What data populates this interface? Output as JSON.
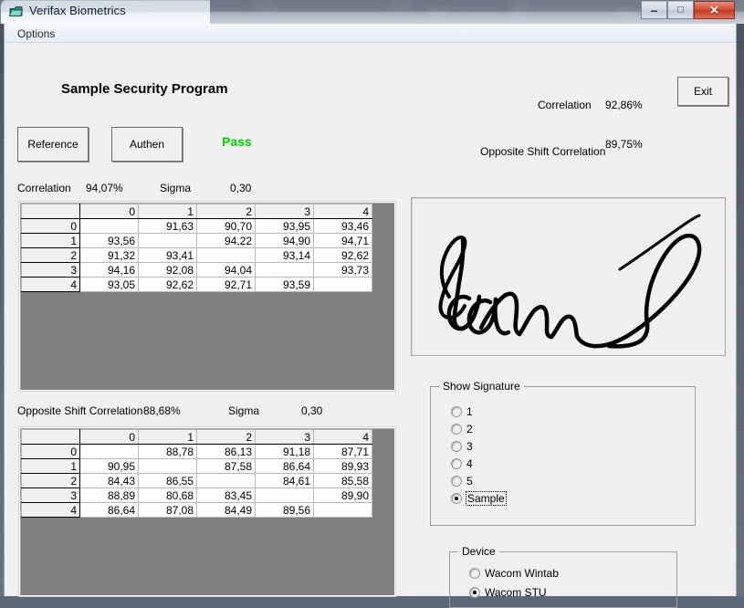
{
  "window": {
    "title": "Verifax Biometrics",
    "icon": "window-app-icon",
    "buttons": {
      "minimize": "minimize-icon",
      "maximize": "maximize-icon",
      "close": "close-icon",
      "minimize_glyph": "–",
      "maximize_glyph": "□",
      "close_glyph": "✕"
    }
  },
  "menu": {
    "items": [
      "Options"
    ],
    "options_label": "Options"
  },
  "main": {
    "heading": "Sample Security Program",
    "reference_button": "Reference",
    "authen_button": "Authen",
    "exit_button": "Exit",
    "pass_label": "Pass",
    "pass_color": "#00d400"
  },
  "summary": {
    "correlation_label": "Correlation",
    "correlation_value": "92,86%",
    "opposite_shift_label": "Opposite Shift Correlation",
    "opposite_shift_value": "89,75%"
  },
  "top_stats": {
    "correlation_label": "Correlation",
    "correlation_value": "94,07%",
    "sigma_label": "Sigma",
    "sigma_value": "0,30"
  },
  "bottom_stats": {
    "correlation_label": "Opposite Shift Correlation",
    "correlation_value": "88,68%",
    "sigma_label": "Sigma",
    "sigma_value": "0,30"
  },
  "grid_top": {
    "columns": [
      "",
      "0",
      "1",
      "2",
      "3",
      "4"
    ],
    "rows": [
      {
        "head": "0",
        "cells": [
          "",
          "91,63",
          "90,70",
          "93,95",
          "93,46"
        ]
      },
      {
        "head": "1",
        "cells": [
          "93,56",
          "",
          "94,22",
          "94,90",
          "94,71"
        ]
      },
      {
        "head": "2",
        "cells": [
          "91,32",
          "93,41",
          "",
          "93,14",
          "92,62"
        ]
      },
      {
        "head": "3",
        "cells": [
          "94,16",
          "92,08",
          "94,04",
          "",
          "93,73"
        ]
      },
      {
        "head": "4",
        "cells": [
          "93,05",
          "92,62",
          "92,71",
          "93,59",
          ""
        ]
      }
    ]
  },
  "grid_bottom": {
    "columns": [
      "",
      "0",
      "1",
      "2",
      "3",
      "4"
    ],
    "rows": [
      {
        "head": "0",
        "cells": [
          "",
          "88,78",
          "86,13",
          "91,18",
          "87,71"
        ]
      },
      {
        "head": "1",
        "cells": [
          "90,95",
          "",
          "87,58",
          "86,64",
          "89,93"
        ]
      },
      {
        "head": "2",
        "cells": [
          "84,43",
          "86,55",
          "",
          "84,61",
          "85,58"
        ]
      },
      {
        "head": "3",
        "cells": [
          "88,89",
          "80,68",
          "83,45",
          "",
          "89,90"
        ]
      },
      {
        "head": "4",
        "cells": [
          "86,64",
          "87,08",
          "84,49",
          "89,56",
          ""
        ]
      }
    ]
  },
  "signature": {
    "name": "signature-preview",
    "ink_color": "#000000",
    "background": "#f0f0f0"
  },
  "show_signature": {
    "title": "Show Signature",
    "options": [
      {
        "label": "1",
        "checked": false,
        "focused": false
      },
      {
        "label": "2",
        "checked": false,
        "focused": false
      },
      {
        "label": "3",
        "checked": false,
        "focused": false
      },
      {
        "label": "4",
        "checked": false,
        "focused": false
      },
      {
        "label": "5",
        "checked": false,
        "focused": false
      },
      {
        "label": "Sample",
        "checked": true,
        "focused": true
      }
    ]
  },
  "device": {
    "title": "Device",
    "options": [
      {
        "label": "Wacom Wintab",
        "checked": false
      },
      {
        "label": "Wacom STU",
        "checked": true
      }
    ]
  }
}
